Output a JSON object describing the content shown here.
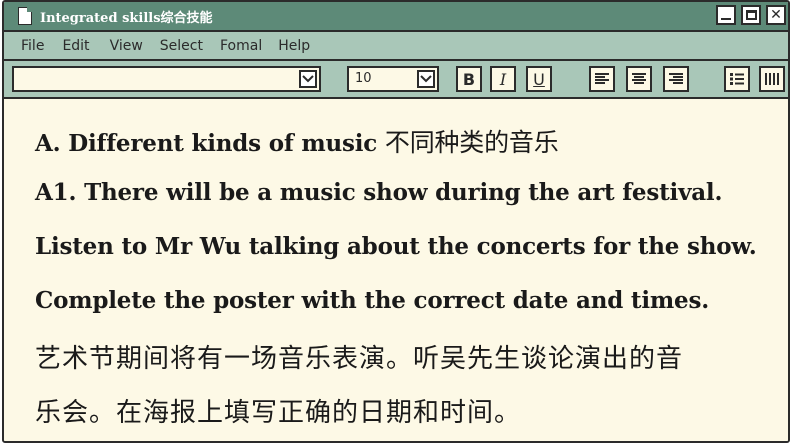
{
  "window": {
    "title": "Integrated skills综合技能",
    "controls": {
      "close": "✕"
    }
  },
  "menu": [
    "File",
    "Edit",
    "View",
    "Select",
    "Fomal",
    "Help"
  ],
  "toolbar": {
    "font_value": "",
    "size_value": "10",
    "bold_label": "B",
    "italic_label": "I",
    "underline_label": "U",
    "icons": [
      "align-left-icon",
      "align-center-icon",
      "align-right-icon",
      "bullet-list-icon",
      "columns-icon"
    ]
  },
  "content": {
    "heading_en": "A. Different kinds of music ",
    "heading_zh": "不同种类的音乐",
    "line1": "A1. There will be a music show during the art festival.",
    "line2": "Listen to Mr Wu talking about the concerts for the show.",
    "line3": "Complete the poster with the correct date and times.",
    "line4": "艺术节期间将有一场音乐表演。听吴先生谈论演出的音",
    "line5": "乐会。在海报上填写正确的日期和时间。"
  }
}
